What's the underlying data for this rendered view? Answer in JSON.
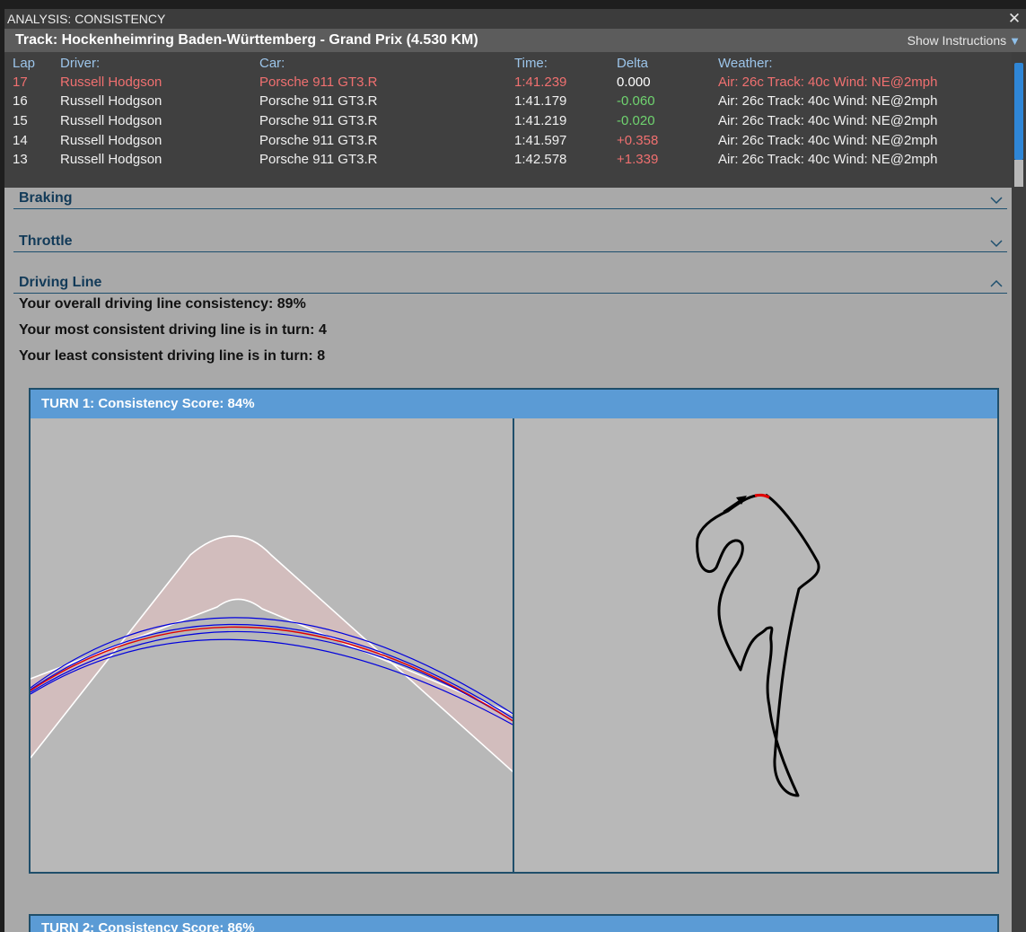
{
  "window": {
    "title": "ANALYSIS: CONSISTENCY",
    "close_glyph": "✕"
  },
  "track": {
    "title": "Track: Hockenheimring Baden-Württemberg - Grand Prix (4.530 KM)",
    "show_instructions": "Show Instructions"
  },
  "laps_table": {
    "headers": {
      "lap": "Lap",
      "driver": "Driver:",
      "car": "Car:",
      "time": "Time:",
      "delta": "Delta",
      "weather": "Weather:"
    },
    "rows": [
      {
        "lap": "17",
        "driver": "Russell Hodgson",
        "car": "Porsche 911 GT3.R",
        "time": "1:41.239",
        "delta": "0.000",
        "weather": "Air: 26c Track: 40c Wind: NE@2mph"
      },
      {
        "lap": "16",
        "driver": "Russell Hodgson",
        "car": "Porsche 911 GT3.R",
        "time": "1:41.179",
        "delta": "-0.060",
        "weather": "Air: 26c Track: 40c Wind: NE@2mph"
      },
      {
        "lap": "15",
        "driver": "Russell Hodgson",
        "car": "Porsche 911 GT3.R",
        "time": "1:41.219",
        "delta": "-0.020",
        "weather": "Air: 26c Track: 40c Wind: NE@2mph"
      },
      {
        "lap": "14",
        "driver": "Russell Hodgson",
        "car": "Porsche 911 GT3.R",
        "time": "1:41.597",
        "delta": "+0.358",
        "weather": "Air: 26c Track: 40c Wind: NE@2mph"
      },
      {
        "lap": "13",
        "driver": "Russell Hodgson",
        "car": "Porsche 911 GT3.R",
        "time": "1:42.578",
        "delta": "+1.339",
        "weather": "Air: 26c Track: 40c Wind: NE@2mph"
      }
    ]
  },
  "sections": {
    "braking": {
      "title": "Braking",
      "expanded": false
    },
    "throttle": {
      "title": "Throttle",
      "expanded": false
    },
    "driving_line": {
      "title": "Driving Line",
      "expanded": true
    }
  },
  "driving_line": {
    "overall": "Your overall driving line consistency: 89%",
    "most": "Your most consistent driving line is in turn: 4",
    "least": "Your least consistent driving line is in turn: 8"
  },
  "turn1": {
    "title": "TURN 1: Consistency Score: 84%"
  },
  "turn2": {
    "title": "TURN 2: Consistency Score: 86%"
  },
  "colors": {
    "accent_blue": "#5b9bd5",
    "best_lap_red": "#f07070",
    "delta_negative": "#6fd36f",
    "line_lap": "#0000dd",
    "line_best": "#e00000"
  },
  "icons": {
    "close": "close-icon",
    "instructions": "triangle-down-icon",
    "collapse": "chevron-up-icon",
    "expand": "chevron-down-icon",
    "direction": "arrow-icon"
  }
}
